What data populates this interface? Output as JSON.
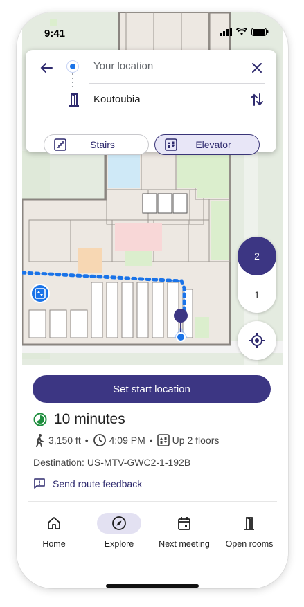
{
  "status_bar": {
    "time": "9:41"
  },
  "route": {
    "from_placeholder": "Your location",
    "to_value": "Koutoubia",
    "mode_options": [
      {
        "label": "Stairs",
        "selected": false
      },
      {
        "label": "Elevator",
        "selected": true
      }
    ]
  },
  "floors": {
    "upper": "2",
    "lower": "1",
    "selected": "2"
  },
  "sheet": {
    "start_button": "Set start location",
    "eta": "10 minutes",
    "distance": "3,150 ft",
    "arrival_time": "4:09 PM",
    "floors_change": "Up 2 floors",
    "destination": "Destination: US-MTV-GWC2-1-192B",
    "feedback": "Send route feedback"
  },
  "nav": {
    "items": [
      {
        "label": "Home",
        "icon": "home-icon"
      },
      {
        "label": "Explore",
        "icon": "compass-icon",
        "active": true
      },
      {
        "label": "Next meeting",
        "icon": "calendar-icon"
      },
      {
        "label": "Open rooms",
        "icon": "door-icon"
      }
    ]
  },
  "colors": {
    "accent": "#3c3683",
    "route": "#1a73e8",
    "eta_green": "#1e8e3e"
  }
}
